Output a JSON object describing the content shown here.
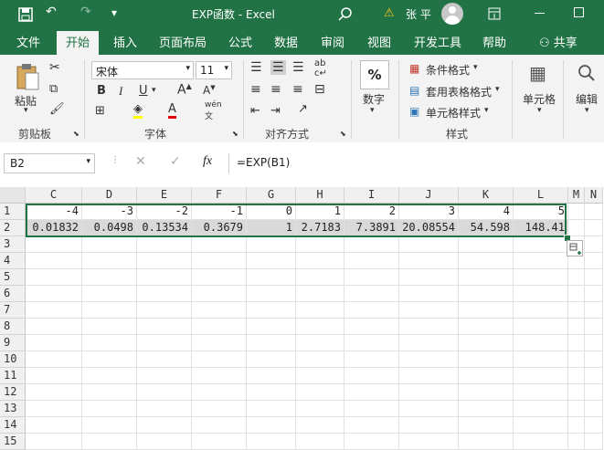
{
  "title": {
    "doc": "EXP函数 - Excel",
    "user": "张 平",
    "warning": "⚠"
  },
  "tabs": [
    "文件",
    "开始",
    "插入",
    "页面布局",
    "公式",
    "数据",
    "审阅",
    "视图",
    "开发工具",
    "帮助"
  ],
  "share": "共享",
  "ribbon": {
    "clipboard": {
      "paste": "粘贴",
      "label": "剪贴板"
    },
    "font": {
      "name": "宋体",
      "size": "11",
      "label": "字体",
      "bold": "B",
      "italic": "I",
      "underline": "U"
    },
    "align": {
      "label": "对齐方式"
    },
    "number": {
      "label": "数字",
      "symbol": "%"
    },
    "styles": {
      "cond": "条件格式",
      "table": "套用表格格式",
      "cell": "单元格样式",
      "label": "样式"
    },
    "cells": {
      "label": "单元格"
    },
    "edit": {
      "label": "编辑"
    }
  },
  "namebox": "B2",
  "formula": "=EXP(B1)",
  "columns": [
    "C",
    "D",
    "E",
    "F",
    "G",
    "H",
    "I",
    "J",
    "K",
    "L",
    "M",
    "N"
  ],
  "rows": [
    "1",
    "2",
    "3",
    "4",
    "5",
    "6",
    "7",
    "8",
    "9",
    "10",
    "11",
    "12",
    "13",
    "14",
    "15"
  ],
  "row1": [
    "-4",
    "-3",
    "-2",
    "-1",
    "0",
    "1",
    "2",
    "3",
    "4",
    "5"
  ],
  "row2": [
    "0.01832",
    "0.0498",
    "0.13534",
    "0.3679",
    "1",
    "2.7183",
    "7.3891",
    "20.08554",
    "54.598",
    "148.41"
  ]
}
